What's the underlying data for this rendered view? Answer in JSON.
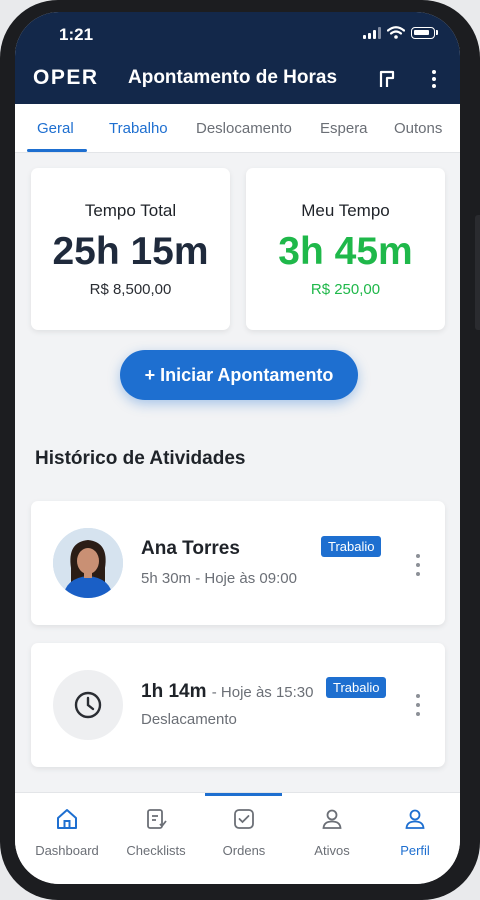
{
  "status_bar": {
    "time": "1:21"
  },
  "header": {
    "logo": "OPER",
    "title": "Apontamento de Horas"
  },
  "tabs": [
    {
      "label": "Geral",
      "active": true
    },
    {
      "label": "Trabalho",
      "active": false
    },
    {
      "label": "Deslocamento",
      "active": false
    },
    {
      "label": "Espera",
      "active": false
    },
    {
      "label": "Outons",
      "active": false
    }
  ],
  "stats": {
    "total": {
      "label": "Tempo Total",
      "value": "25h 15m",
      "amount": "R$ 8,500,00"
    },
    "mine": {
      "label": "Meu Tempo",
      "value": "3h 45m",
      "amount": "R$ 250,00"
    }
  },
  "cta": {
    "label": "+ Iniciar Apontamento"
  },
  "history": {
    "title": "Histórico de Atividades",
    "items": [
      {
        "name": "Ana Torres",
        "meta": "5h 30m - Hoje às 09:00",
        "badge": "Trabalio",
        "avatar": "person-photo"
      },
      {
        "duration": "1h 14m",
        "time": "- Hoje às 15:30",
        "meta": "Deslacamento",
        "badge": "Trabalio",
        "avatar": "clock-icon"
      }
    ]
  },
  "bottom_nav": [
    {
      "label": "Dashboard",
      "icon": "home-icon"
    },
    {
      "label": "Checklists",
      "icon": "checklist-icon"
    },
    {
      "label": "Ordens",
      "icon": "check-square-icon"
    },
    {
      "label": "Ativos",
      "icon": "user-icon"
    },
    {
      "label": "Perfil",
      "icon": "user-icon",
      "active": true
    }
  ],
  "colors": {
    "primary": "#1e6fd0",
    "header_bg": "#13284a",
    "success": "#1fb84a"
  }
}
